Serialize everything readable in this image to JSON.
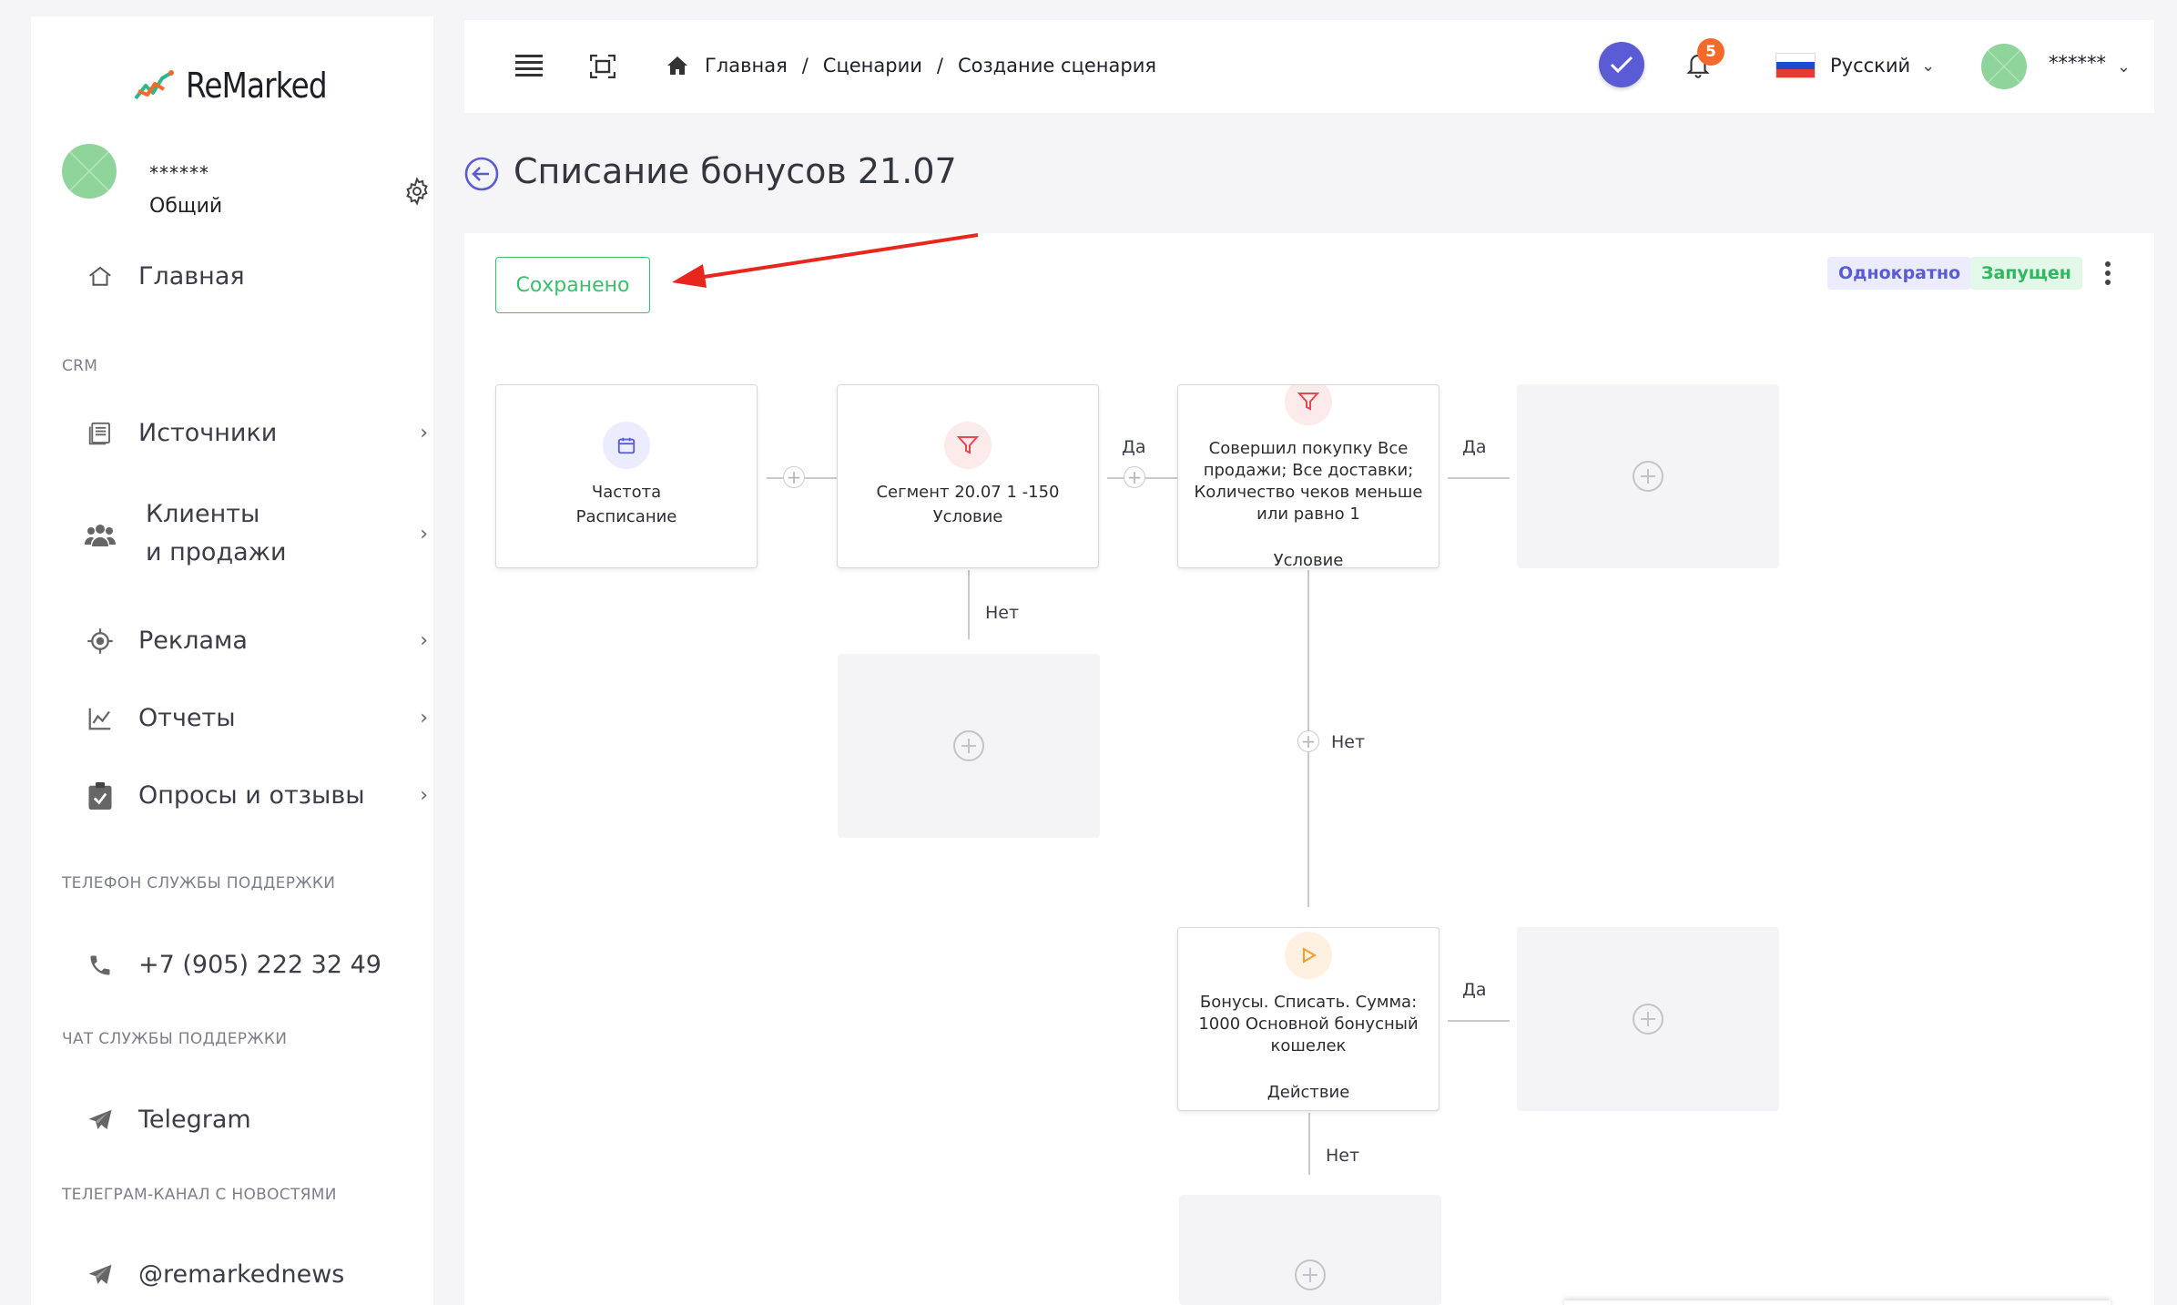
{
  "sidebar": {
    "brand": "ReMarked",
    "profile": {
      "name": "******",
      "role": "Общий"
    },
    "nav": [
      {
        "label": "Главная"
      },
      {
        "label": "Источники"
      },
      {
        "label": "Клиенты",
        "label2": "и продажи"
      },
      {
        "label": "Реклама"
      },
      {
        "label": "Отчеты"
      },
      {
        "label": "Опросы и отзывы"
      }
    ],
    "sections": {
      "crm": "CRM",
      "phone": "ТЕЛЕФОН СЛУЖБЫ ПОДДЕРЖКИ",
      "chat": "ЧАТ СЛУЖБЫ ПОДДЕРЖКИ",
      "channel": "ТЕЛЕГРАМ-КАНАЛ С НОВОСТЯМИ"
    },
    "phone": "+7 (905) 222 32 49",
    "chat": "Telegram",
    "channel": "@remarkednews"
  },
  "topbar": {
    "breadcrumbs": [
      "Главная",
      "Сценарии",
      "Создание сценария"
    ],
    "notifications": "5",
    "language": "Русский",
    "user": "******"
  },
  "page": {
    "title": "Списание бонусов 21.07",
    "saved_button": "Сохранено",
    "tags": {
      "frequency": "Однократно",
      "status": "Запущен"
    }
  },
  "flow": {
    "nodes": {
      "n1": {
        "title": "Частота",
        "type": "Расписание"
      },
      "n2": {
        "title": "Сегмент 20.07 1 -150",
        "type": "Условие"
      },
      "n3": {
        "title": "Совершил покупку Все продажи; Все доставки; Количество чеков меньше или равно 1",
        "type": "Условие"
      },
      "n4": {
        "title": "Бонусы. Списать. Сумма: 1000 Основной бонусный кошелек",
        "type": "Действие"
      }
    },
    "labels": {
      "yes": "Да",
      "no": "Нет"
    }
  },
  "colors": {
    "accent": "#5b5bd6",
    "success": "#37c06d",
    "condition": "#e5484d",
    "action": "#f59e2a",
    "badge": "#f56a2a"
  }
}
